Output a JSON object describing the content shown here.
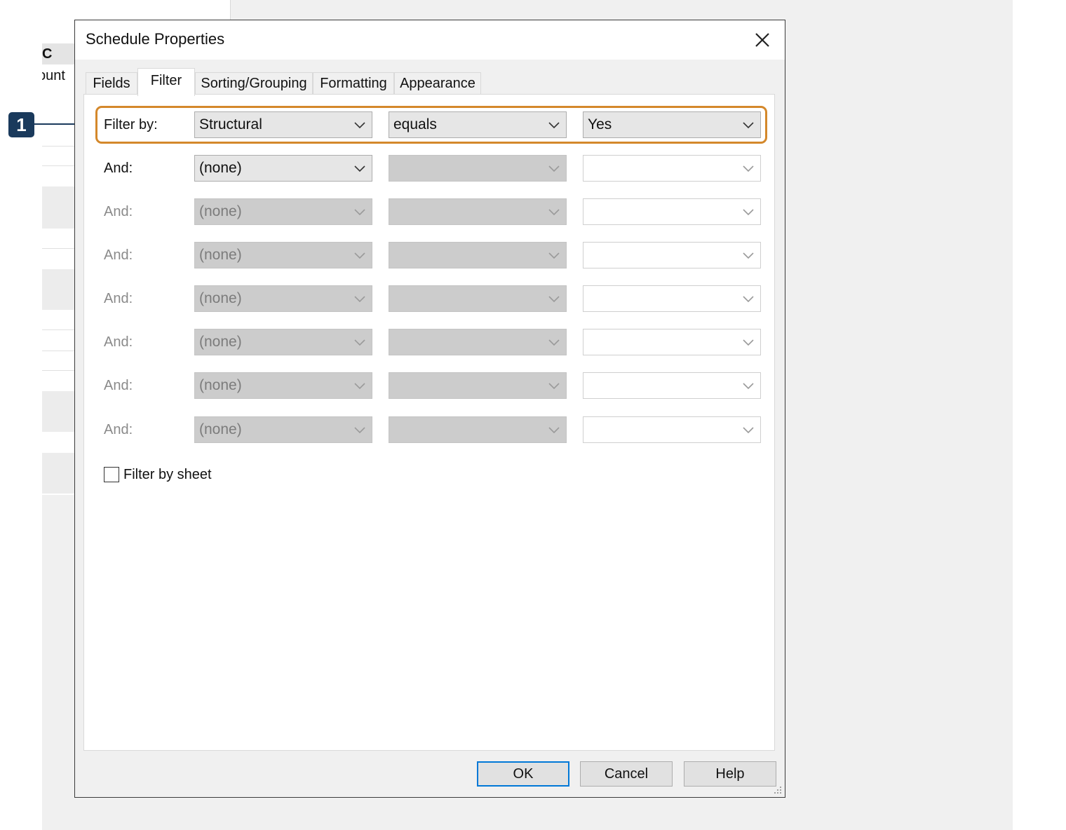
{
  "background_window": {
    "header_partial": "C",
    "subheader_partial": "ount"
  },
  "callout": {
    "number": "1"
  },
  "dialog": {
    "title": "Schedule Properties",
    "tabs": [
      {
        "label": "Fields",
        "active": false
      },
      {
        "label": "Filter",
        "active": true
      },
      {
        "label": "Sorting/Grouping",
        "active": false
      },
      {
        "label": "Formatting",
        "active": false
      },
      {
        "label": "Appearance",
        "active": false
      }
    ],
    "filters": [
      {
        "label": "Filter by:",
        "field": "Structural",
        "operator": "equals",
        "value": "Yes",
        "enabled": true
      },
      {
        "label": "And:",
        "field": "(none)",
        "operator": "",
        "value": "",
        "enabled": true
      },
      {
        "label": "And:",
        "field": "(none)",
        "operator": "",
        "value": "",
        "enabled": false
      },
      {
        "label": "And:",
        "field": "(none)",
        "operator": "",
        "value": "",
        "enabled": false
      },
      {
        "label": "And:",
        "field": "(none)",
        "operator": "",
        "value": "",
        "enabled": false
      },
      {
        "label": "And:",
        "field": "(none)",
        "operator": "",
        "value": "",
        "enabled": false
      },
      {
        "label": "And:",
        "field": "(none)",
        "operator": "",
        "value": "",
        "enabled": false
      },
      {
        "label": "And:",
        "field": "(none)",
        "operator": "",
        "value": "",
        "enabled": false
      }
    ],
    "filter_by_sheet": {
      "label": "Filter by sheet",
      "checked": false
    },
    "buttons": {
      "ok": "OK",
      "cancel": "Cancel",
      "help": "Help"
    }
  },
  "colors": {
    "highlight": "#d4882b",
    "callout": "#1a3a5c",
    "default_button_border": "#0078d7"
  },
  "icons": {
    "close": "close-icon",
    "dropdown": "chevron-down-icon",
    "resize": "resize-grip-icon"
  }
}
